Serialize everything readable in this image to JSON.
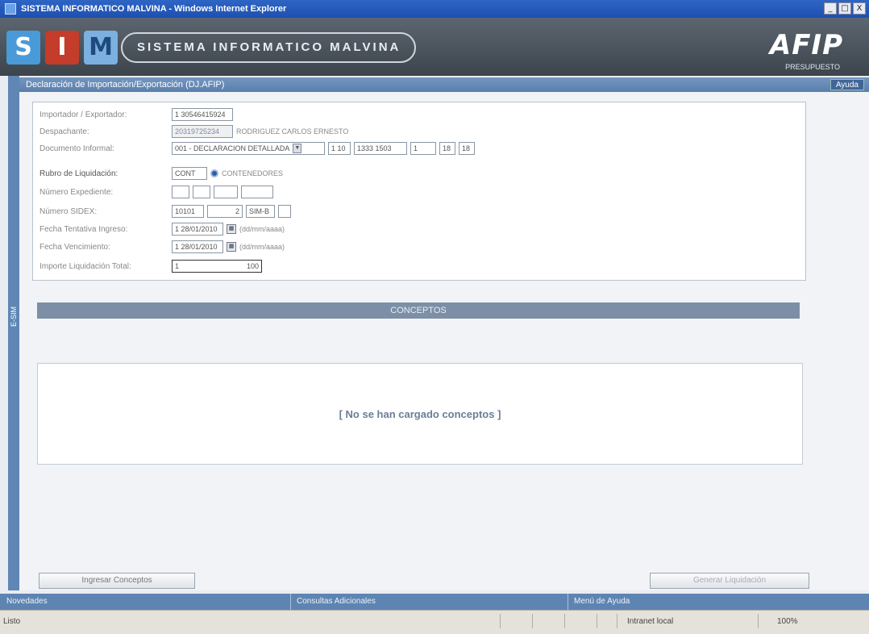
{
  "window": {
    "title": "SISTEMA INFORMATICO MALVINA - Windows Internet Explorer",
    "minimize": "_",
    "maximize": "□",
    "close": "X"
  },
  "banner": {
    "logo_s": "S",
    "logo_i": "I",
    "logo_m": "M",
    "system_name": "SISTEMA INFORMATICO MALVINA",
    "brand": "AFIP",
    "brand_sub": "PRESUPUESTO"
  },
  "rail_label": "E-SIM",
  "section": {
    "title": "Declaración de Importación/Exportación (DJ.AFIP)",
    "help_label": "Ayuda"
  },
  "form": {
    "rows": [
      {
        "label": "Importador / Exportador:",
        "value": "1 30546415924"
      },
      {
        "label": "Despachante:",
        "value": "20319725234",
        "extra": "RODRIGUEZ CARLOS ERNESTO"
      },
      {
        "label": "Documento Informal:",
        "select": "001 - DECLARACION DETALLADA",
        "f1": "1 10",
        "f2": "1333 1503",
        "f3": "1",
        "f4": "18",
        "f5": "18"
      },
      {
        "label": "Rubro de Liquidación:",
        "value": "CONT",
        "extra": "CONTENEDORES"
      },
      {
        "label": "Número Expediente:"
      },
      {
        "label": "Número SIDEX:",
        "f1": "10101",
        "f2": "2",
        "f3": "SIM-B"
      },
      {
        "label": "Fecha Tentativa Ingreso:",
        "value": "1 28/01/2010",
        "extra": "(dd/mm/aaaa)"
      },
      {
        "label": "Fecha Vencimiento:",
        "value": "1 28/01/2010",
        "extra": "(dd/mm/aaaa)"
      },
      {
        "label": "Importe Liquidación Total:",
        "value": "1",
        "amount": "100"
      }
    ]
  },
  "conceptos": {
    "header": "CONCEPTOS",
    "empty_message": "[ No se han cargado conceptos ]"
  },
  "buttons": {
    "ingresar": "Ingresar Conceptos",
    "generar": "Generar Liquidación"
  },
  "footer": {
    "item1": "Novedades",
    "item2": "Consultas Adicionales",
    "item3": "Menú de Ayuda"
  },
  "statusbar": {
    "left": "Listo",
    "zone": "Intranet local",
    "zoom": "100%"
  }
}
